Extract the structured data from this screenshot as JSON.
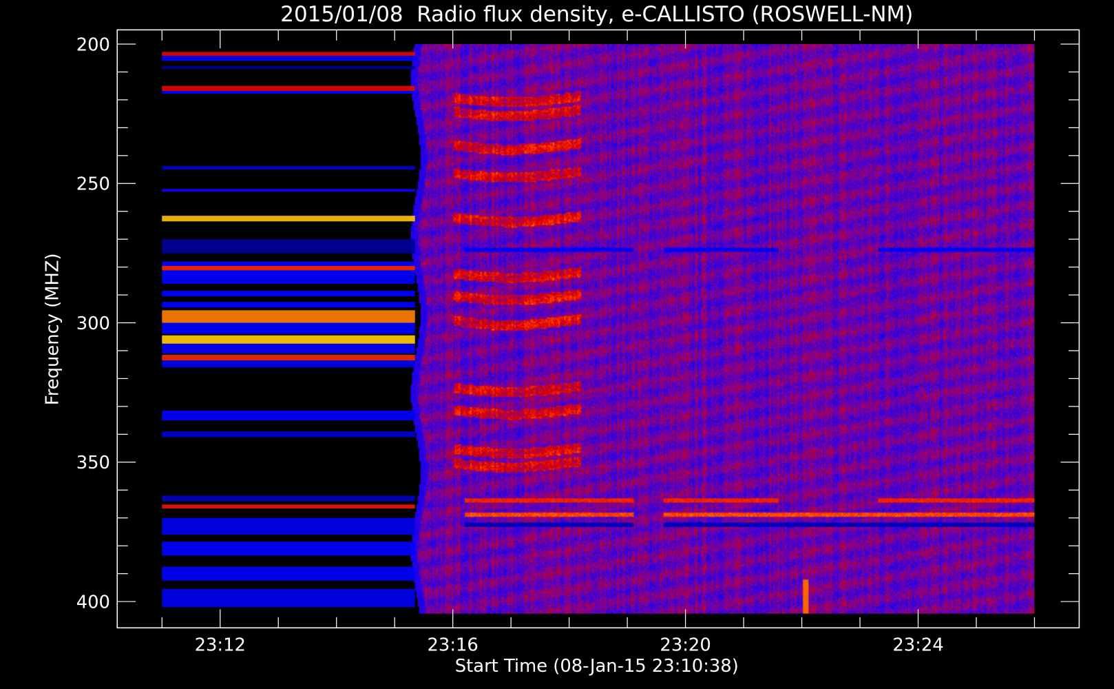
{
  "chart_data": {
    "type": "heatmap",
    "title": "2015/01/08  Radio flux density, e-CALLISTO (ROSWELL-NM)",
    "xlabel": "Start Time (08-Jan-15 23:10:38)",
    "ylabel": "Frequency (MHZ)",
    "x_range_minutes": [
      10.25,
      26.75
    ],
    "data_time_range_minutes": [
      11,
      26
    ],
    "y_range_mhz": [
      404.5,
      195
    ],
    "data_freq_range_mhz": [
      200,
      404.3
    ],
    "x_ticks": [
      {
        "min": 12,
        "label": "23:12"
      },
      {
        "min": 16,
        "label": "23:16"
      },
      {
        "min": 20,
        "label": "23:20"
      },
      {
        "min": 24,
        "label": "23:24"
      }
    ],
    "x_minor_step_min": 1,
    "y_ticks": [
      {
        "mhz": 200,
        "label": "200"
      },
      {
        "mhz": 250,
        "label": "250"
      },
      {
        "mhz": 300,
        "label": "300"
      },
      {
        "mhz": 350,
        "label": "350"
      },
      {
        "mhz": 400,
        "label": "400"
      }
    ],
    "y_minor_step_mhz": 10,
    "colormap": [
      "#000000",
      "#0000ff",
      "#6a00b4",
      "#dc0000",
      "#ff3c00",
      "#ffff00"
    ],
    "receiver_onset_min": 15.35,
    "pre_onset_bands": [
      {
        "f0": 202.8,
        "f1": 204.2,
        "level": 0.72
      },
      {
        "f0": 204.2,
        "f1": 206,
        "level": 0.3
      },
      {
        "f0": 208,
        "f1": 209,
        "level": 0.18
      },
      {
        "f0": 215,
        "f1": 216.8,
        "level": 0.72
      },
      {
        "f0": 216.8,
        "f1": 217.8,
        "level": 0.3
      },
      {
        "f0": 243.8,
        "f1": 245,
        "level": 0.25
      },
      {
        "f0": 252,
        "f1": 253,
        "level": 0.32
      },
      {
        "f0": 261.6,
        "f1": 263.6,
        "level": 0.95
      },
      {
        "f0": 270,
        "f1": 275,
        "level": 0.18
      },
      {
        "f0": 278,
        "f1": 279.6,
        "level": 0.32
      },
      {
        "f0": 279.6,
        "f1": 281.2,
        "level": 0.8
      },
      {
        "f0": 281.2,
        "f1": 286,
        "level": 0.3
      },
      {
        "f0": 288.5,
        "f1": 290.5,
        "level": 0.3
      },
      {
        "f0": 292.5,
        "f1": 294.5,
        "level": 0.3
      },
      {
        "f0": 295.5,
        "f1": 300,
        "level": 0.9
      },
      {
        "f0": 300,
        "f1": 304,
        "level": 0.3
      },
      {
        "f0": 304.5,
        "f1": 307.5,
        "level": 0.96
      },
      {
        "f0": 307.5,
        "f1": 311,
        "level": 0.32
      },
      {
        "f0": 311.5,
        "f1": 313.5,
        "level": 0.8
      },
      {
        "f0": 313.5,
        "f1": 316,
        "level": 0.28
      },
      {
        "f0": 331.5,
        "f1": 335,
        "level": 0.3
      },
      {
        "f0": 339,
        "f1": 341,
        "level": 0.25
      },
      {
        "f0": 362,
        "f1": 364,
        "level": 0.22
      },
      {
        "f0": 365.2,
        "f1": 366.6,
        "level": 0.75
      },
      {
        "f0": 370,
        "f1": 376,
        "level": 0.28
      },
      {
        "f0": 378.5,
        "f1": 383.5,
        "level": 0.3
      },
      {
        "f0": 387.5,
        "f1": 392.5,
        "level": 0.3
      },
      {
        "f0": 395.5,
        "f1": 402,
        "level": 0.28
      }
    ],
    "drifting_stripes": {
      "t_range_min": [
        16,
        18.2
      ],
      "center_freqs_mhz": [
        219,
        224,
        236,
        246,
        262,
        282,
        290,
        299,
        323,
        331,
        345,
        350
      ]
    },
    "rfi_lines": [
      {
        "mhz": 363.5,
        "level": 0.78
      },
      {
        "mhz": 368.5,
        "level": 0.85
      },
      {
        "mhz": 372,
        "level": 0.22
      },
      {
        "mhz": 273.5,
        "level": 0.3
      }
    ],
    "spike": {
      "time_min": 22.05,
      "f0": 392,
      "f1": 404.3,
      "level": 0.88
    }
  }
}
